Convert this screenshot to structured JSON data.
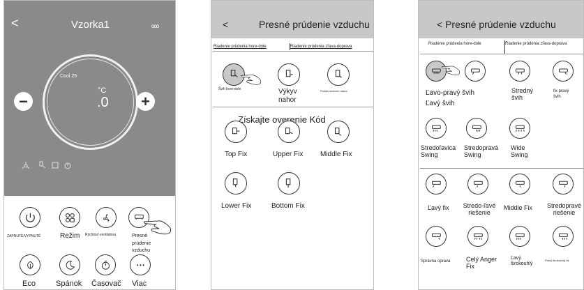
{
  "screen1": {
    "title": "Vzorka1",
    "back": "<",
    "more": "ooo",
    "mode_text": "Cool 25",
    "temp_unit": "°C",
    "temp_value": ".0",
    "minus": "−",
    "plus": "+",
    "buttons": [
      {
        "label": "ZAPNUTÉ/VYPNUTÉ",
        "icon": "power-icon"
      },
      {
        "label": "Režim",
        "icon": "mode-icon"
      },
      {
        "label": "Rýchlosť ventilátora",
        "icon": "fan-speed-icon"
      },
      {
        "label": "Presné prúdenie vzduchu",
        "icon": "airflow-icon"
      },
      {
        "label": "Eco",
        "icon": "eco-leaf-icon"
      },
      {
        "label": "Spánok",
        "icon": "sleep-moon-icon"
      },
      {
        "label": "Časovač",
        "icon": "timer-icon"
      },
      {
        "label": "Viac",
        "icon": "more-dots-icon"
      }
    ]
  },
  "screen2": {
    "back": "<",
    "title": "Presné prúdenie vzduchu",
    "tab1": "Riadenie prúdenia hore-dole",
    "tab2": "Riadenie prúdenia zľava-doprava",
    "row1": [
      "Švih hore-dole",
      "Výkyv nahor",
      "Pokles smerom nadol"
    ],
    "overlay": "Získajte overenie Kód",
    "row2": [
      "Top Fix",
      "Upper Fix",
      "Middle Fix"
    ],
    "row3": [
      "Lower Fix",
      "Bottom Fix"
    ]
  },
  "screen3": {
    "title": "< Presné prúdenie vzduchu",
    "tab1": "Riadenie prúdenia hore-dole",
    "tab2": "Riadenie prúdenia zľava-doprava",
    "row1_main": "Ľavo-pravý švih",
    "row1_sub": "Ľavý švih",
    "row1": [
      "Stredný švih",
      "fix pravý švih"
    ],
    "row2": [
      "Stredoľavica Swing",
      "Stredopravá Swing",
      "Wide Swing"
    ],
    "row3": [
      "Ľavý fix",
      "Stredo-ľavé riešenie",
      "Middle Fix",
      "Stredopravé riešenie"
    ],
    "row4": [
      "Správna oprava",
      "Celý Anger Fix",
      "Ľavý širokouhlý",
      "Pravý širokouhlý fix"
    ]
  },
  "colors": {
    "screen1_bg": "#8a8a8a",
    "accent": "#c8c8c8",
    "line": "#333333"
  }
}
